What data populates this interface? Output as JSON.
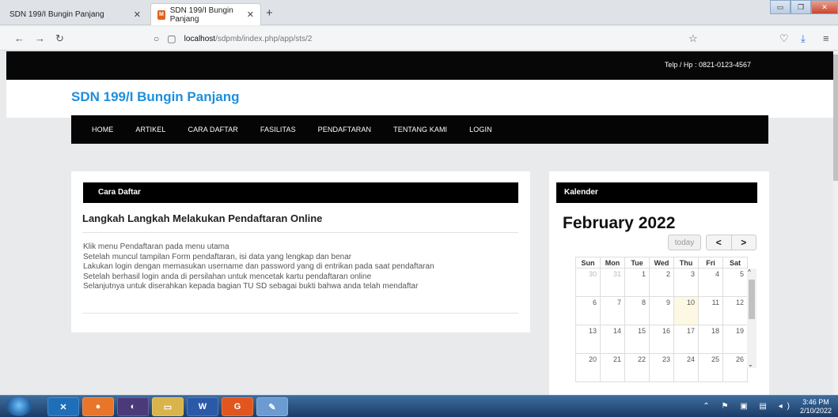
{
  "browser": {
    "tabs": [
      {
        "label": "SDN 199/I Bungin Panjang",
        "active": true
      },
      {
        "label": "SDN 199/I Bungin Panjang",
        "active": false
      }
    ],
    "url_host": "localhost",
    "url_path": "/sdpmb/index.php/app/sts/2"
  },
  "site": {
    "phone": "Telp / Hp : 0821-0123-4567",
    "title": "SDN 199/I Bungin Panjang",
    "menu": [
      "HOME",
      "ARTIKEL",
      "CARA DAFTAR",
      "FASILITAS",
      "PENDAFTARAN",
      "TENTANG KAMI",
      "LOGIN"
    ]
  },
  "main": {
    "section_label": "Cara Daftar",
    "heading": "Langkah Langkah Melakukan Pendaftaran Online",
    "steps": [
      "Klik menu Pendaftaran pada menu utama",
      "Setelah muncul tampilan Form pendaftaran, isi data yang lengkap dan benar",
      "Lakukan login dengan memasukan username dan password yang di entrikan pada saat pendaftaran",
      "Setelah berhasil login anda di persilahan untuk mencetak kartu pendaftaran online",
      "Selanjutnya untuk diserahkan kepada bagian TU SD sebagai bukti bahwa anda telah mendaftar"
    ]
  },
  "sidebar": {
    "section_label": "Kalender",
    "month_title": "February 2022",
    "today_label": "today",
    "prev_glyph": "<",
    "next_glyph": ">",
    "weekdays": [
      "Sun",
      "Mon",
      "Tue",
      "Wed",
      "Thu",
      "Fri",
      "Sat"
    ],
    "weeks": [
      [
        "30",
        "31",
        "1",
        "2",
        "3",
        "4",
        "5"
      ],
      [
        "6",
        "7",
        "8",
        "9",
        "10",
        "11",
        "12"
      ],
      [
        "13",
        "14",
        "15",
        "16",
        "17",
        "18",
        "19"
      ],
      [
        "20",
        "21",
        "22",
        "23",
        "24",
        "25",
        "26"
      ]
    ],
    "other_month_days": [
      "30",
      "31"
    ],
    "today_day": "10"
  },
  "taskbar": {
    "time": "3:46 PM",
    "date": "2/10/2022",
    "apps": [
      "vscode",
      "firefox",
      "eclipse",
      "files",
      "W",
      "pdf",
      "paint"
    ]
  },
  "colors": {
    "title_blue": "#1e8fdc",
    "menu_bg": "#050505",
    "today_bg": "#fcf8e3"
  }
}
